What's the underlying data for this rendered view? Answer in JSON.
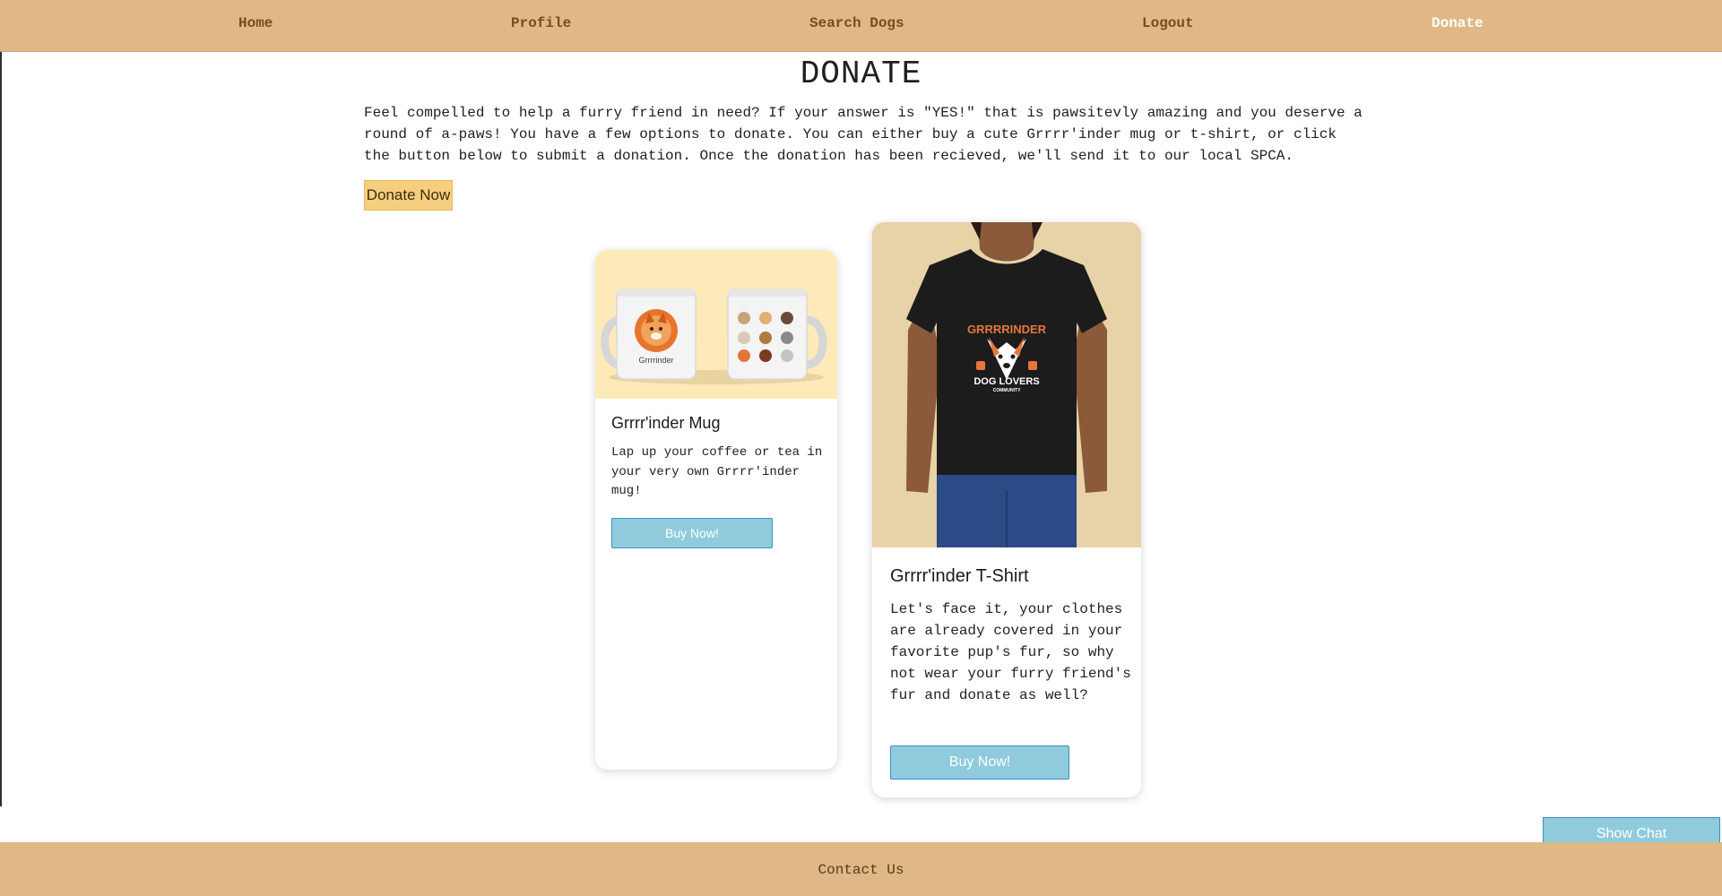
{
  "nav": {
    "home": "Home",
    "profile": "Profile",
    "search_dogs": "Search Dogs",
    "logout": "Logout",
    "donate": "Donate"
  },
  "page": {
    "title": "DONATE",
    "intro": "Feel compelled to help a furry friend in need? If your answer is \"YES!\" that is pawsitevly amazing and you deserve a round of a-paws! You have a few options to donate. You can either buy a cute Grrrr'inder mug or t-shirt, or click the button below to submit a donation. Once the donation has been recieved, we'll send it to our local SPCA.",
    "donate_button": "Donate Now"
  },
  "products": {
    "mug": {
      "title": "Grrrr'inder Mug",
      "description": "Lap up your coffee or tea in your very own Grrrr'inder mug!",
      "button": "Buy Now!",
      "logo_text": "Grrrrinder"
    },
    "shirt": {
      "title": "Grrrr'inder T-Shirt",
      "description": "Let's face it, your clothes are already covered in your favorite pup's fur, so why not wear your furry friend's fur and donate as well?",
      "button": "Buy Now!",
      "logo_text": "GRRRRINDER",
      "logo_subtext": "DOG LOVERS",
      "logo_subtext2": "COMMUNITY"
    }
  },
  "chat": {
    "button": "Show Chat"
  },
  "footer": {
    "contact": "Contact Us"
  },
  "colors": {
    "nav_bg": "#dfb886",
    "nav_text": "#7a4a1f",
    "donate_button_bg": "#f6cf7e",
    "buy_button_bg": "#8fcbdc",
    "buy_button_border": "#3a8fc4"
  }
}
